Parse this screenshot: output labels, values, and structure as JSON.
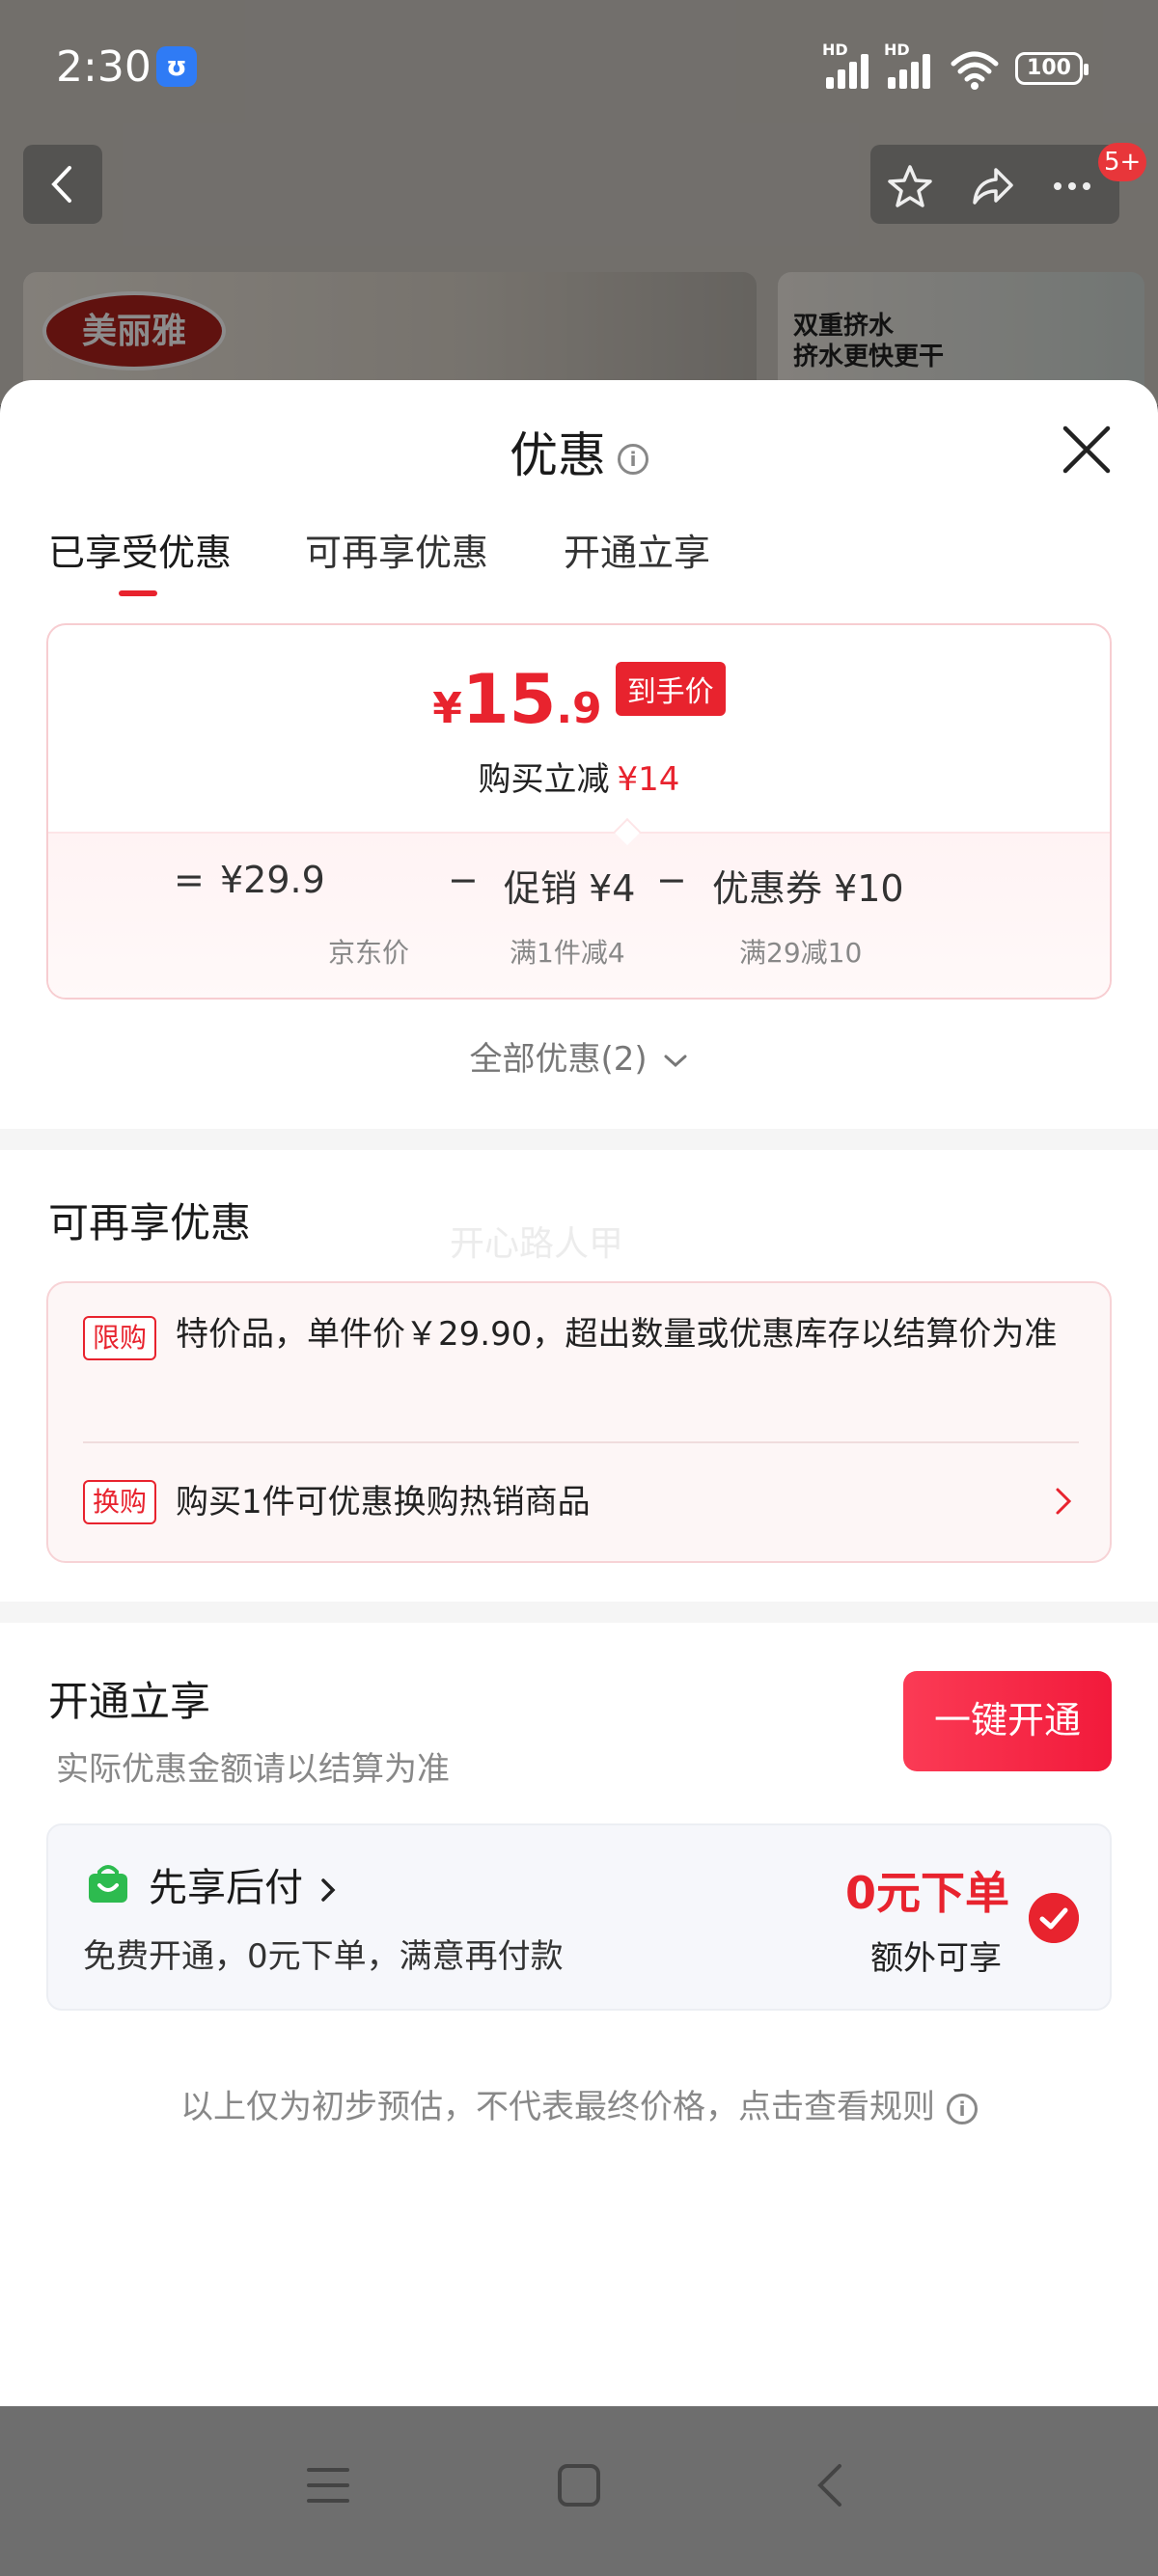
{
  "status_bar": {
    "time": "2:30",
    "battery": "100",
    "hd1": "HD",
    "hd2": "HD"
  },
  "nav": {
    "badge": "5+"
  },
  "background": {
    "brand_logo": "美丽雅",
    "banner_text_1": "双重挤水",
    "banner_text_2": "挤水更快更干"
  },
  "sheet": {
    "title": "优惠",
    "tabs": [
      "已享受优惠",
      "可再享优惠",
      "开通立享"
    ],
    "active_tab": 0
  },
  "price_card": {
    "yen": "¥",
    "price_int": "15",
    "price_dec": ".9",
    "price_tag": "到手价",
    "reduce_label": "购买立减",
    "reduce_amount": "¥14",
    "breakdown": {
      "eq": "=",
      "jd_price": "¥29.9",
      "minus1": "−",
      "promo": "促销 ¥4",
      "minus2": "−",
      "coupon": "优惠券 ¥10",
      "jd_label": "京东价",
      "promo_label": "满1件减4",
      "coupon_label": "满29减10"
    }
  },
  "all_offers": "全部优惠(2)",
  "more_section": {
    "title": "可再享优惠",
    "watermark": "开心路人甲",
    "items": [
      {
        "tag": "限购",
        "text": "特价品，单件价￥29.90，超出数量或优惠库存以结算价为准"
      },
      {
        "tag": "换购",
        "text": "购买1件可优惠换购热销商品"
      }
    ]
  },
  "open_section": {
    "title": "开通立享",
    "subtitle": "实际优惠金额请以结算为准",
    "button": "一键开通",
    "pay_name": "先享后付",
    "pay_desc": "免费开通，0元下单，满意再付款",
    "pay_zero": "0元下单",
    "pay_extra": "额外可享"
  },
  "footer_note": "以上仅为初步预估，不代表最终价格，点击查看规则",
  "colors": {
    "accent": "#e8232e",
    "brand_gradient_start": "#fb3b55"
  }
}
